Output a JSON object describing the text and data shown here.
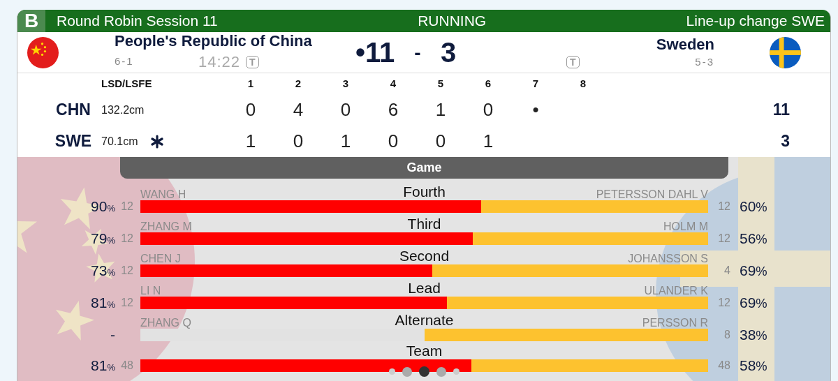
{
  "header": {
    "court": "B",
    "session": "Round Robin Session 11",
    "status": "RUNNING",
    "notice": "Line-up change SWE"
  },
  "teams": [
    {
      "kind": "china",
      "name": "People's Republic of China",
      "record": "6-1",
      "score": "•11",
      "clock": {
        "time": "14:22",
        "badge": "T"
      }
    },
    {
      "kind": "sweden",
      "name": "Sweden",
      "record": "5-3",
      "score": "3",
      "clock": {
        "badge": "T"
      }
    }
  ],
  "score_separator": "-",
  "ends": {
    "lsd_heading": "LSD/LSFE",
    "end_numbers": [
      "1",
      "2",
      "3",
      "4",
      "5",
      "6",
      "7",
      "8"
    ],
    "rows": [
      {
        "team": "CHN",
        "lsd": "132.2cm",
        "hammer": false,
        "scores": [
          "0",
          "4",
          "0",
          "6",
          "1",
          "0",
          "•"
        ],
        "total": "11"
      },
      {
        "team": "SWE",
        "lsd": "70.1cm",
        "hammer": true,
        "scores": [
          "1",
          "0",
          "1",
          "0",
          "0",
          "1"
        ],
        "total": "3"
      }
    ]
  },
  "section_tab": "Game",
  "positions": [
    {
      "position": "Fourth",
      "home": {
        "player": "WANG H",
        "count": "12",
        "pct": "90",
        "unit": "%",
        "level": 0.6
      },
      "away": {
        "player": "PETERSSON DAHL V",
        "count": "12",
        "pct": "60",
        "unit": "%",
        "level": 0.4
      }
    },
    {
      "position": "Third",
      "home": {
        "player": "ZHANG M",
        "count": "12",
        "pct": "79",
        "unit": "%",
        "level": 0.585
      },
      "away": {
        "player": "HOLM M",
        "count": "12",
        "pct": "56",
        "unit": "%",
        "level": 0.415
      }
    },
    {
      "position": "Second",
      "home": {
        "player": "CHEN J",
        "count": "12",
        "pct": "73",
        "unit": "%",
        "level": 0.514
      },
      "away": {
        "player": "JOHANSSON S",
        "count": "4",
        "pct": "69",
        "unit": "%",
        "level": 0.486
      }
    },
    {
      "position": "Lead",
      "home": {
        "player": "LI N",
        "count": "12",
        "pct": "81",
        "unit": "%",
        "level": 0.54
      },
      "away": {
        "player": "ULANDER K",
        "count": "12",
        "pct": "69",
        "unit": "%",
        "level": 0.46
      }
    },
    {
      "position": "Alternate",
      "home": {
        "player": "ZHANG Q",
        "pct": "-"
      },
      "away": {
        "player": "PERSSON R",
        "count": "8",
        "pct": "38",
        "unit": "%",
        "level": 0.5
      }
    },
    {
      "position": "Team",
      "home": {
        "count": "48",
        "pct": "81",
        "unit": "%",
        "level": 0.583
      },
      "away": {
        "count": "48",
        "pct": "58",
        "unit": "%",
        "level": 0.417
      }
    }
  ],
  "pager": [
    {
      "selected": false
    },
    {
      "selected": false
    },
    {
      "selected": true
    },
    {
      "selected": false
    },
    {
      "selected": false
    }
  ]
}
